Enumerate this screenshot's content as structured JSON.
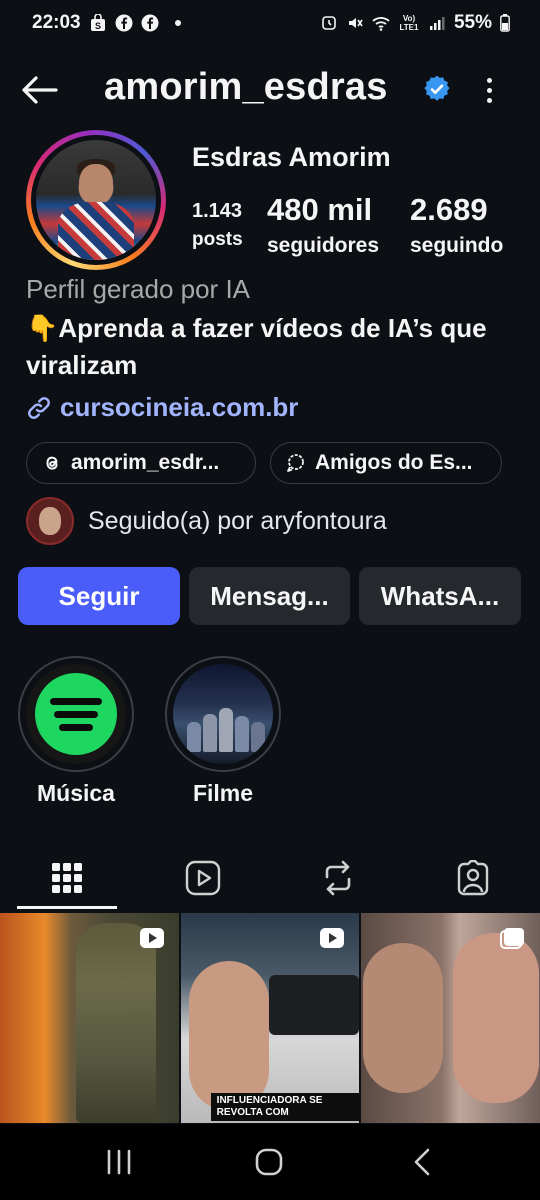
{
  "status_bar": {
    "time": "22:03",
    "battery": "55%",
    "network": "Vo) LTE1"
  },
  "header": {
    "username": "amorim_esdras",
    "back_icon": "arrow-left-icon",
    "verified_icon": "verified-badge-icon",
    "more_icon": "more-vertical-icon"
  },
  "profile": {
    "full_name": "Esdras Amorim",
    "stats": {
      "posts_count": "1.143",
      "posts_label": "posts",
      "followers_count": "480 mil",
      "followers_label": "seguidores",
      "following_count": "2.689",
      "following_label": "seguindo"
    },
    "ai_label": "Perfil gerado por IA",
    "bio": "👇Aprenda a fazer vídeos de IA’s que viralizam",
    "link": "cursocineia.com.br",
    "chips": {
      "threads": "amorim_esdr...",
      "friends": "Amigos do Es..."
    },
    "followed_by": "Seguido(a) por aryfontoura"
  },
  "actions": {
    "follow": "Seguir",
    "message": "Mensag...",
    "whatsapp": "WhatsA..."
  },
  "highlights": [
    {
      "label": "Música"
    },
    {
      "label": "Filme"
    }
  ],
  "post_captions": {
    "influencer": "INFLUENCIADORA SE REVOLTA COM"
  },
  "colors": {
    "background": "#0c1014",
    "follow_button": "#4a5df9",
    "secondary_button": "#25292e",
    "link": "#a3b4ff",
    "verified": "#3897f0"
  }
}
